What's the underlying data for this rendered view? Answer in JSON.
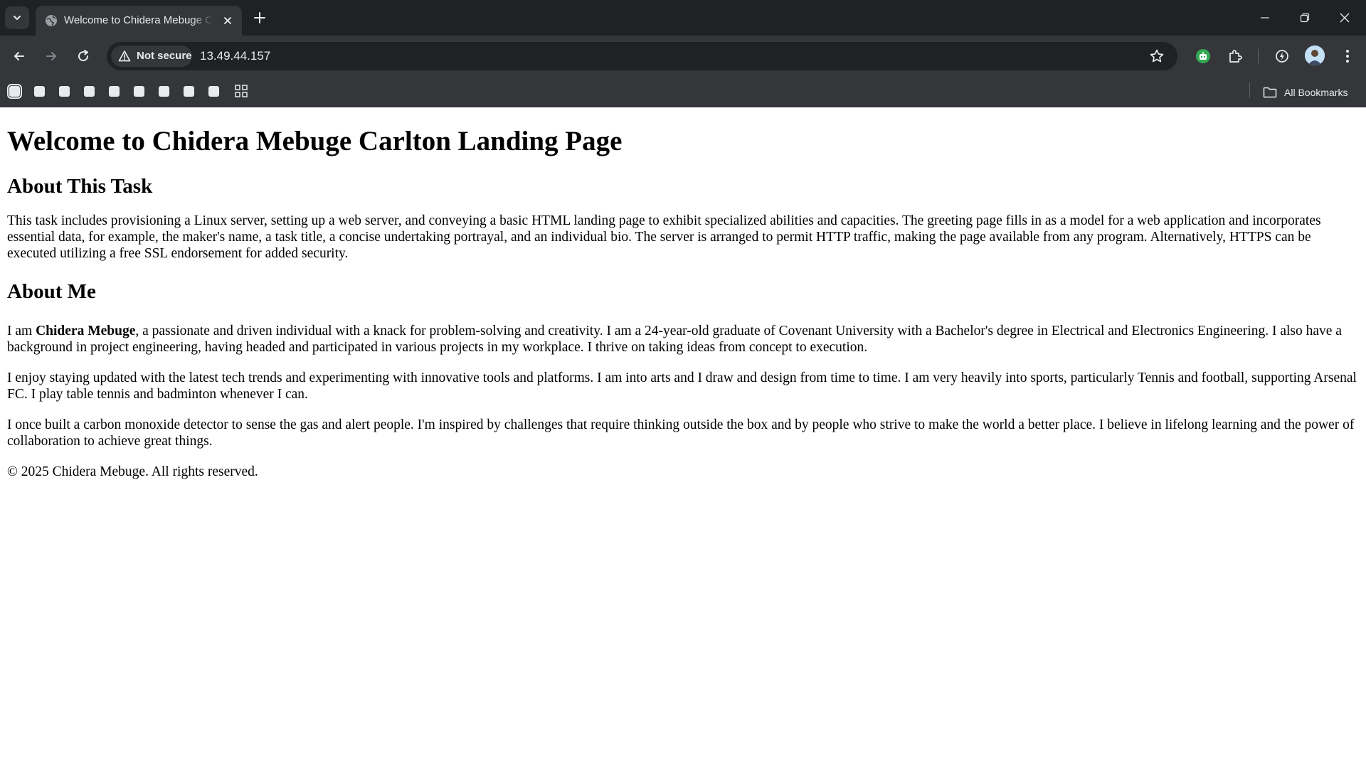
{
  "browser": {
    "tab": {
      "title": "Welcome to Chidera Mebuge Carlton Landing Page"
    },
    "address_bar": {
      "security_label": "Not secure",
      "url": "13.49.44.157"
    },
    "bookmarks_bar": {
      "items": [
        "",
        "",
        "",
        "",
        "",
        "",
        "",
        "",
        ""
      ],
      "all_bookmarks_label": "All Bookmarks"
    },
    "colors": {
      "titlebar": "#202124",
      "toolbar": "#35363a",
      "text": "#e8eaed"
    }
  },
  "page": {
    "title": "Welcome to Chidera Mebuge Carlton Landing Page",
    "task_heading": "About This Task",
    "task_text": "This task includes provisioning a Linux server, setting up a web server, and conveying a basic HTML landing page to exhibit specialized abilities and capacities. The greeting page fills in as a model for a web application and incorporates essential data, for example, the maker's name, a task title, a concise undertaking portrayal, and an individual bio. The server is arranged to permit HTTP traffic, making the page available from any program. Alternatively, HTTPS can be executed utilizing a free SSL endorsement for added security.",
    "about_heading": "About Me",
    "about_p1_prefix": "I am ",
    "about_p1_name": "Chidera Mebuge",
    "about_p1_rest": ", a passionate and driven individual with a knack for problem-solving and creativity. I am a 24-year-old graduate of Covenant University with a Bachelor's degree in Electrical and Electronics Engineering. I also have a background in project engineering, having headed and participated in various projects in my workplace. I thrive on taking ideas from concept to execution.",
    "about_p2": "I enjoy staying updated with the latest tech trends and experimenting with innovative tools and platforms. I am into arts and I draw and design from time to time. I am very heavily into sports, particularly Tennis and football, supporting Arsenal FC. I play table tennis and badminton whenever I can.",
    "about_p3": "I once built a carbon monoxide detector to sense the gas and alert people. I'm inspired by challenges that require thinking outside the box and by people who strive to make the world a better place. I believe in lifelong learning and the power of collaboration to achieve great things.",
    "footer": "© 2025 Chidera Mebuge. All rights reserved."
  },
  "icons": {
    "tab_search": "chevron-down-icon",
    "tab_favicon": "globe-icon",
    "tab_close": "close-icon",
    "new_tab": "plus-icon",
    "back": "arrow-left-icon",
    "forward": "arrow-right-icon",
    "reload": "reload-icon",
    "warning": "warning-triangle-icon",
    "bookmark_star": "star-icon",
    "extension_green": "robot-extension-icon",
    "extensions": "puzzle-icon",
    "performance": "performance-icon",
    "menu": "kebab-menu-icon",
    "apps": "apps-grid-icon",
    "folder": "folder-icon"
  }
}
